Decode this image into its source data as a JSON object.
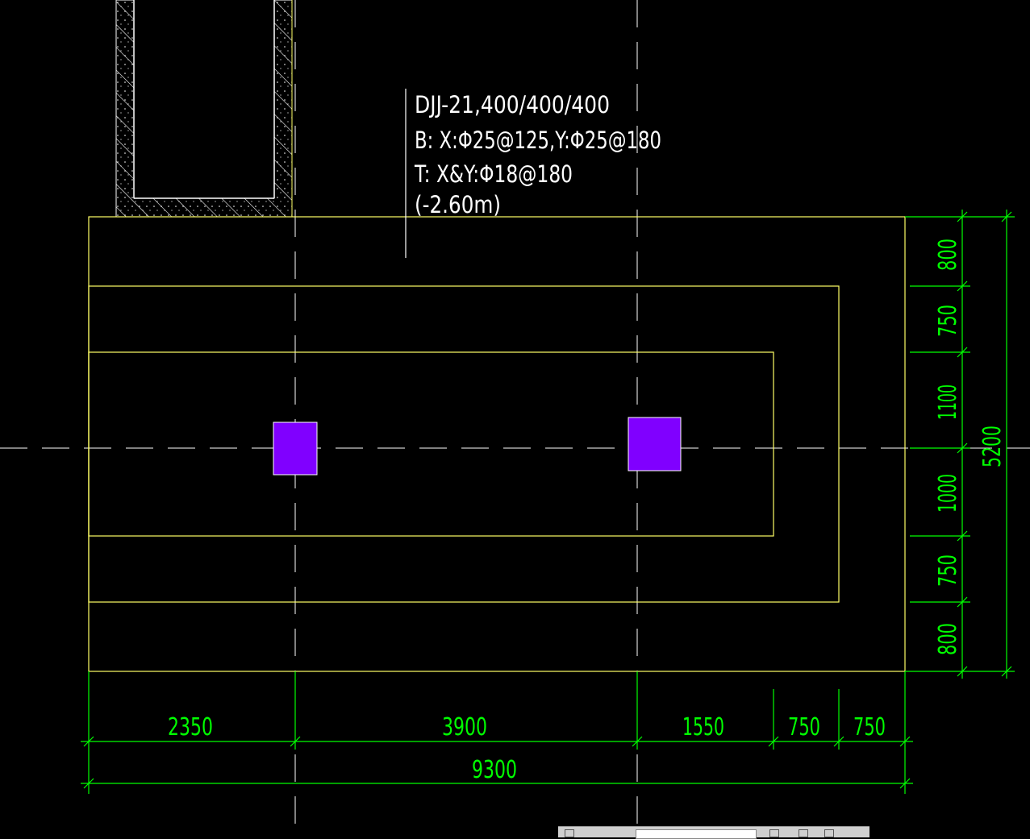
{
  "annotation": {
    "lines": [
      "DJJ-21,400/400/400",
      "B: X:Φ25@125,Y:Φ25@180",
      "T: X&Y:Φ18@180",
      "(-2.60m)"
    ]
  },
  "dimensions": {
    "horizontal_segments": [
      "2350",
      "3900",
      "1550",
      "750",
      "750"
    ],
    "horizontal_total": "9300",
    "vertical_segments": [
      "800",
      "750",
      "1100",
      "1000",
      "750",
      "800"
    ],
    "vertical_total": "5200"
  },
  "colors": {
    "background": "#000000",
    "outline": "#ffff66",
    "column": "#8000ff",
    "dimension": "#00ff00",
    "text": "#ffffff",
    "hatch": "#ffffff"
  },
  "icons": {
    "status_bar": [
      "grid-icon",
      "arrow-icon",
      "snap-icon",
      "lock-icon"
    ]
  }
}
